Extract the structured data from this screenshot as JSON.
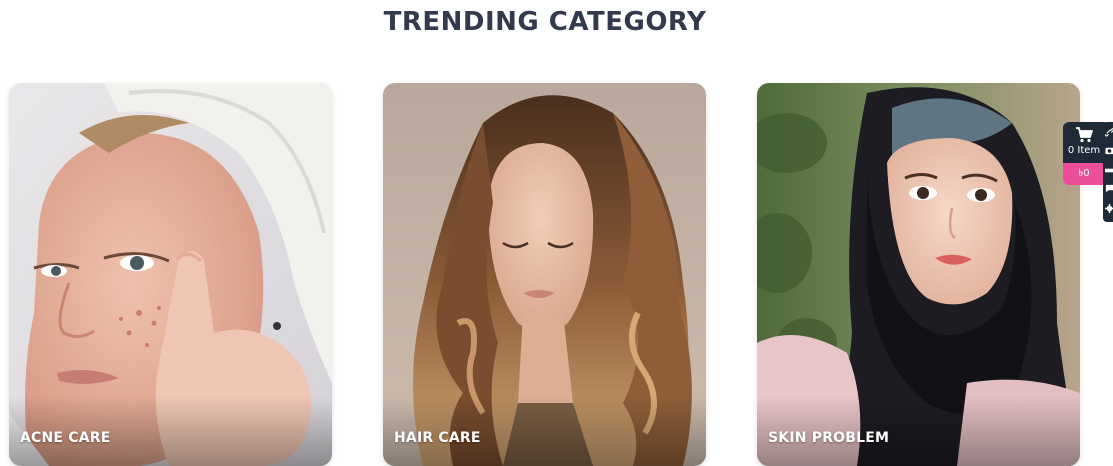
{
  "section": {
    "title": "TRENDING CATEGORY"
  },
  "categories": [
    {
      "label": "ACNE CARE"
    },
    {
      "label": "HAIR CARE"
    },
    {
      "label": "SKIN PROBLEM"
    }
  ],
  "cart": {
    "items_label": "0 Item",
    "total_label": "৳0"
  },
  "colors": {
    "title": "#343a4d",
    "cart_dark": "#1e2a38",
    "cart_pink": "#ec4e9a"
  },
  "icons": {
    "cart": "shopping-cart-icon",
    "tools": [
      "link-icon",
      "eye-icon",
      "compare-icon",
      "chat-icon",
      "gear-icon"
    ]
  }
}
